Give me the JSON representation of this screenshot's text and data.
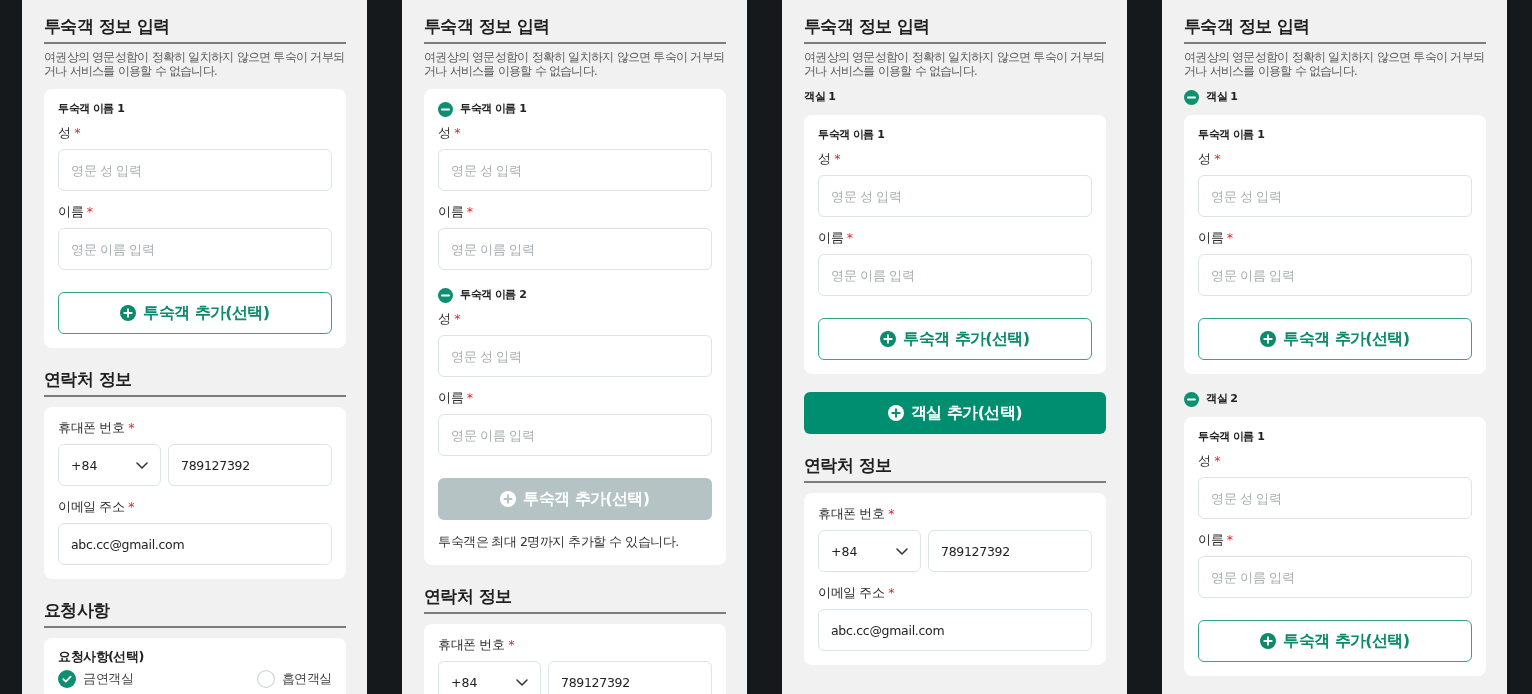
{
  "screens": [
    {
      "guest_info": {
        "title": "투숙객 정보 입력",
        "notice": "여권상의 영문성함이 정확히 일치하지 않으면 투숙이 거부되거나 서비스를 이용할 수 없습니다.",
        "rooms": [
          {
            "guests": [
              {
                "label": "투숙객 이름 1",
                "removable": false,
                "fields": [
                  {
                    "label": "성",
                    "required_mark": "*",
                    "placeholder": "영문 성 입력"
                  },
                  {
                    "label": "이름",
                    "required_mark": "*",
                    "placeholder": "영문 이름 입력"
                  }
                ]
              }
            ],
            "add_guest_button": {
              "label": "투숙객 추가(선택)",
              "disabled": false
            }
          }
        ]
      },
      "contact": {
        "title": "연락처 정보",
        "fields": [
          {
            "kind": "phone",
            "label": "휴대폰 번호",
            "required_mark": "*",
            "country_code": "+84",
            "value": "789127392"
          },
          {
            "kind": "email",
            "label": "이메일 주소",
            "required_mark": "*",
            "value": "abc.cc@gmail.com"
          }
        ]
      },
      "requests": {
        "title": "요청사항",
        "card_title": "요청사항(선택)",
        "options": [
          {
            "label": "금연객실",
            "selected": true
          },
          {
            "label": "흡연객실",
            "selected": false
          }
        ]
      }
    },
    {
      "guest_info": {
        "title": "투숙객 정보 입력",
        "notice": "여권상의 영문성함이 정확히 일치하지 않으면 투숙이 거부되거나 서비스를 이용할 수 없습니다.",
        "rooms": [
          {
            "guests": [
              {
                "label": "투숙객 이름 1",
                "removable": true,
                "fields": [
                  {
                    "label": "성",
                    "required_mark": "*",
                    "placeholder": "영문 성 입력"
                  },
                  {
                    "label": "이름",
                    "required_mark": "*",
                    "placeholder": "영문 이름 입력"
                  }
                ]
              },
              {
                "label": "투숙객 이름 2",
                "removable": true,
                "fields": [
                  {
                    "label": "성",
                    "required_mark": "*",
                    "placeholder": "영문 성 입력"
                  },
                  {
                    "label": "이름",
                    "required_mark": "*",
                    "placeholder": "영문 이름 입력"
                  }
                ]
              }
            ],
            "add_guest_button": {
              "label": "투숙객 추가(선택)",
              "disabled": true
            },
            "limit_note": "투숙객은 최대 2명까지 추가할 수 있습니다."
          }
        ]
      },
      "contact": {
        "title": "연락처 정보",
        "fields": [
          {
            "kind": "phone",
            "label": "휴대폰 번호",
            "required_mark": "*",
            "country_code": "+84",
            "value": "789127392"
          }
        ]
      }
    },
    {
      "guest_info": {
        "title": "투숙객 정보 입력",
        "notice": "여권상의 영문성함이 정확히 일치하지 않으면 투숙이 거부되거나 서비스를 이용할 수 없습니다.",
        "rooms": [
          {
            "label": "객실 1",
            "removable": false,
            "guests": [
              {
                "label": "투숙객 이름 1",
                "removable": false,
                "fields": [
                  {
                    "label": "성",
                    "required_mark": "*",
                    "placeholder": "영문 성 입력"
                  },
                  {
                    "label": "이름",
                    "required_mark": "*",
                    "placeholder": "영문 이름 입력"
                  }
                ]
              }
            ],
            "add_guest_button": {
              "label": "투숙객 추가(선택)",
              "disabled": false
            }
          }
        ],
        "add_room_button": {
          "label": "객실 추가(선택)"
        }
      },
      "contact": {
        "title": "연락처 정보",
        "fields": [
          {
            "kind": "phone",
            "label": "휴대폰 번호",
            "required_mark": "*",
            "country_code": "+84",
            "value": "789127392"
          },
          {
            "kind": "email",
            "label": "이메일 주소",
            "required_mark": "*",
            "value": "abc.cc@gmail.com"
          }
        ]
      }
    },
    {
      "guest_info": {
        "title": "투숙객 정보 입력",
        "notice": "여권상의 영문성함이 정확히 일치하지 않으면 투숙이 거부되거나 서비스를 이용할 수 없습니다.",
        "rooms": [
          {
            "label": "객실 1",
            "removable": true,
            "guests": [
              {
                "label": "투숙객 이름 1",
                "removable": false,
                "fields": [
                  {
                    "label": "성",
                    "required_mark": "*",
                    "placeholder": "영문 성 입력"
                  },
                  {
                    "label": "이름",
                    "required_mark": "*",
                    "placeholder": "영문 이름 입력"
                  }
                ]
              }
            ],
            "add_guest_button": {
              "label": "투숙객 추가(선택)",
              "disabled": false
            }
          },
          {
            "label": "객실 2",
            "removable": true,
            "guests": [
              {
                "label": "투숙객 이름 1",
                "removable": false,
                "fields": [
                  {
                    "label": "성",
                    "required_mark": "*",
                    "placeholder": "영문 성 입력"
                  },
                  {
                    "label": "이름",
                    "required_mark": "*",
                    "placeholder": "영문 이름 입력"
                  }
                ]
              }
            ],
            "add_guest_button": {
              "label": "투숙객 추가(선택)",
              "disabled": false
            }
          }
        ]
      }
    }
  ]
}
